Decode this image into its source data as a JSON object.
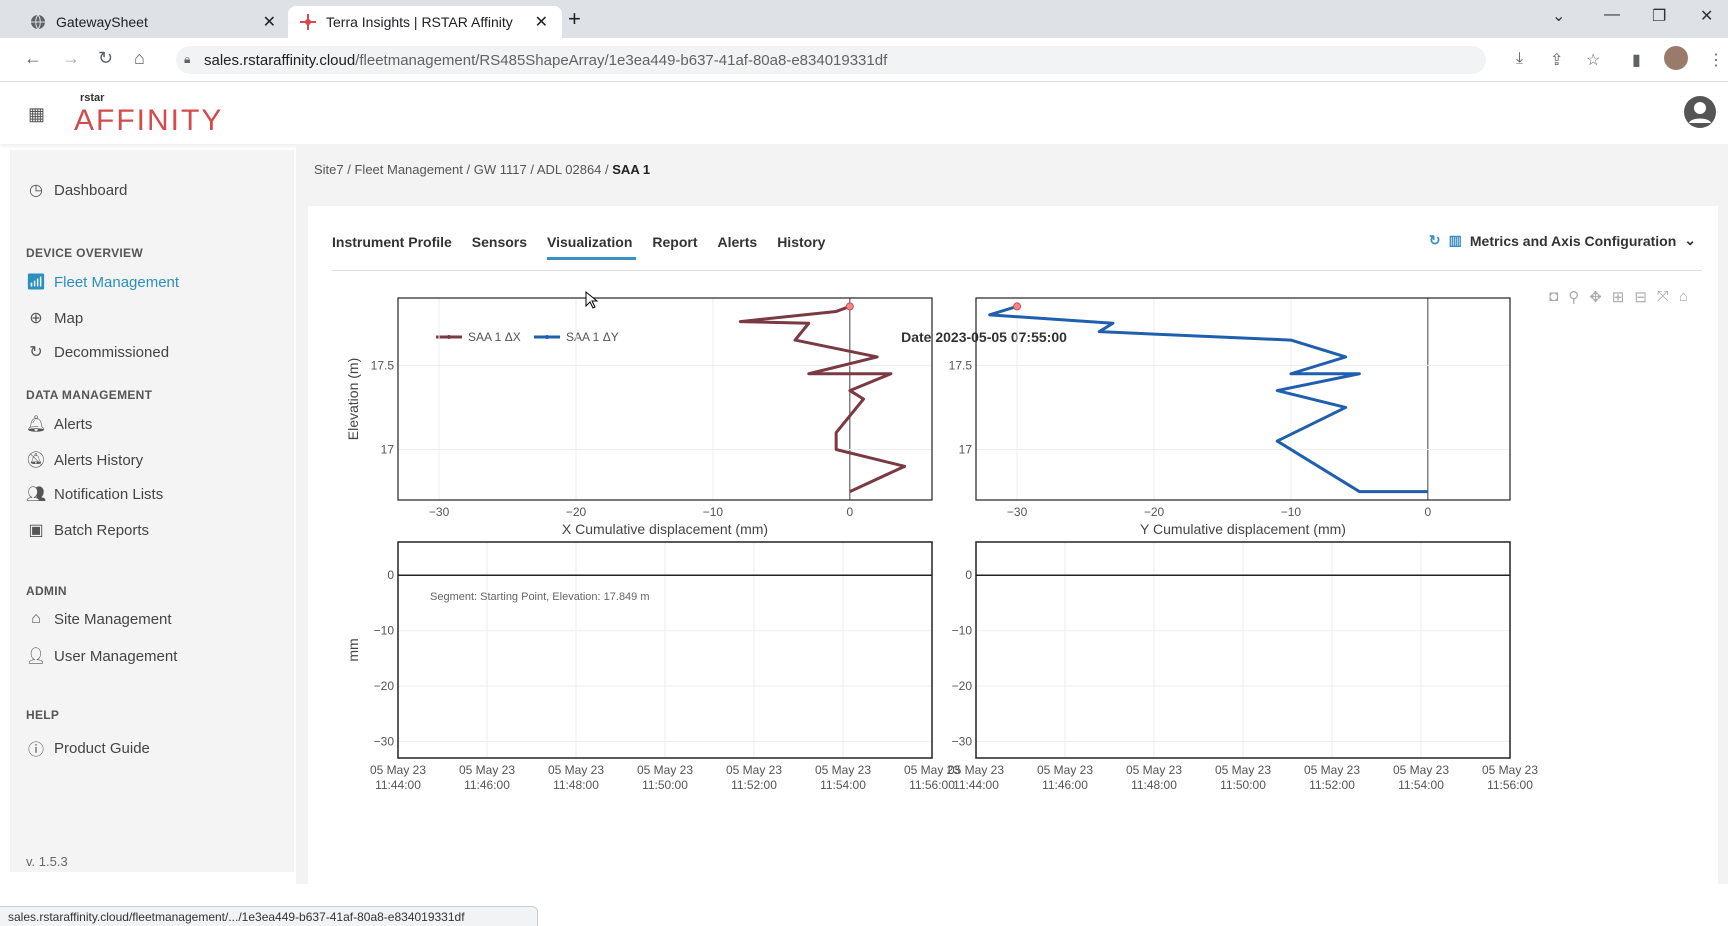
{
  "browser": {
    "tabs": [
      {
        "title": "GatewaySheet",
        "active": false
      },
      {
        "title": "Terra Insights | RSTAR Affinity",
        "active": true
      }
    ],
    "url_host": "sales.rstaraffinity.cloud",
    "url_path": "/fleetmanagement/RS485ShapeArray/1e3ea449-b637-41af-80a8-e834019331df",
    "status_url": "sales.rstaraffinity.cloud/fleetmanagement/.../1e3ea449-b637-41af-80a8-e834019331df"
  },
  "app": {
    "logo_small": "rstar",
    "logo_big": "AFFINITY"
  },
  "sidebar": {
    "dashboard": "Dashboard",
    "device_overview": "DEVICE OVERVIEW",
    "fleet_management": "Fleet Management",
    "map": "Map",
    "decommissioned": "Decommissioned",
    "data_management": "DATA MANAGEMENT",
    "alerts": "Alerts",
    "alerts_history": "Alerts History",
    "notification_lists": "Notification Lists",
    "batch_reports": "Batch Reports",
    "admin": "ADMIN",
    "site_management": "Site Management",
    "user_management": "User Management",
    "help": "HELP",
    "product_guide": "Product Guide",
    "version": "v. 1.5.3"
  },
  "breadcrumb": {
    "items": [
      "Site7",
      "Fleet Management",
      "GW 1117",
      "ADL 02864"
    ],
    "current": "SAA 1"
  },
  "tabs": {
    "instrument_profile": "Instrument Profile",
    "sensors": "Sensors",
    "visualization": "Visualization",
    "report": "Report",
    "alerts": "Alerts",
    "history": "History"
  },
  "metrics_label": "Metrics and Axis Configuration",
  "chart_title": "Date 2023-05-05 07:55:00",
  "segment_text": "Segment:  Starting Point, Elevation: 17.849 m",
  "chart_data": [
    {
      "type": "line",
      "series": [
        {
          "name": "SAA 1 ΔX",
          "color": "#7a3a44",
          "x": [
            0,
            -1,
            -8,
            -3,
            -4,
            2,
            -3,
            3,
            0,
            1,
            -1,
            -1,
            4,
            0
          ],
          "y": [
            17.85,
            17.82,
            17.76,
            17.75,
            17.65,
            17.55,
            17.45,
            17.45,
            17.35,
            17.3,
            17.1,
            17.0,
            16.9,
            16.75
          ]
        }
      ],
      "xlabel": "X Cumulative displacement (mm)",
      "ylabel": "Elevation (m)",
      "xlim": [
        -33,
        6
      ],
      "ylim": [
        16.7,
        17.9
      ],
      "xticks": [
        -30,
        -20,
        -10,
        0
      ],
      "yticks": [
        17,
        17.5
      ]
    },
    {
      "type": "line",
      "series": [
        {
          "name": "SAA 1 ΔY",
          "color": "#1f5fae",
          "x": [
            -30,
            -32,
            -23,
            -24,
            -10,
            -6,
            -10,
            -5,
            -11,
            -6,
            -11,
            -9,
            -5,
            0
          ],
          "y": [
            17.85,
            17.8,
            17.75,
            17.7,
            17.65,
            17.55,
            17.45,
            17.45,
            17.35,
            17.25,
            17.05,
            16.95,
            16.75,
            16.75
          ]
        }
      ],
      "xlabel": "Y Cumulative displacement (mm)",
      "ylabel": "",
      "xlim": [
        -33,
        6
      ],
      "ylim": [
        16.7,
        17.9
      ],
      "xticks": [
        -30,
        -20,
        -10,
        0
      ],
      "yticks": [
        17,
        17.5
      ]
    },
    {
      "type": "line",
      "ylabel": "mm",
      "ylim": [
        -33,
        6
      ],
      "yticks": [
        0,
        -10,
        -20,
        -30
      ],
      "xticks": [
        "05 May 23\n11:44:00",
        "05 May 23\n11:46:00",
        "05 May 23\n11:48:00",
        "05 May 23\n11:50:00",
        "05 May 23\n11:52:00",
        "05 May 23\n11:54:00",
        "05 May 23\n11:56:00"
      ],
      "series": [
        {
          "name": "",
          "values": [
            0,
            0
          ]
        }
      ]
    },
    {
      "type": "line",
      "ylabel": "",
      "ylim": [
        -33,
        6
      ],
      "yticks": [
        0,
        -10,
        -20,
        -30
      ],
      "xticks": [
        "05 May 23\n11:44:00",
        "05 May 23\n11:46:00",
        "05 May 23\n11:48:00",
        "05 May 23\n11:50:00",
        "05 May 23\n11:52:00",
        "05 May 23\n11:54:00",
        "05 May 23\n11:56:00"
      ],
      "series": [
        {
          "name": "",
          "values": [
            0,
            0
          ]
        }
      ]
    }
  ]
}
